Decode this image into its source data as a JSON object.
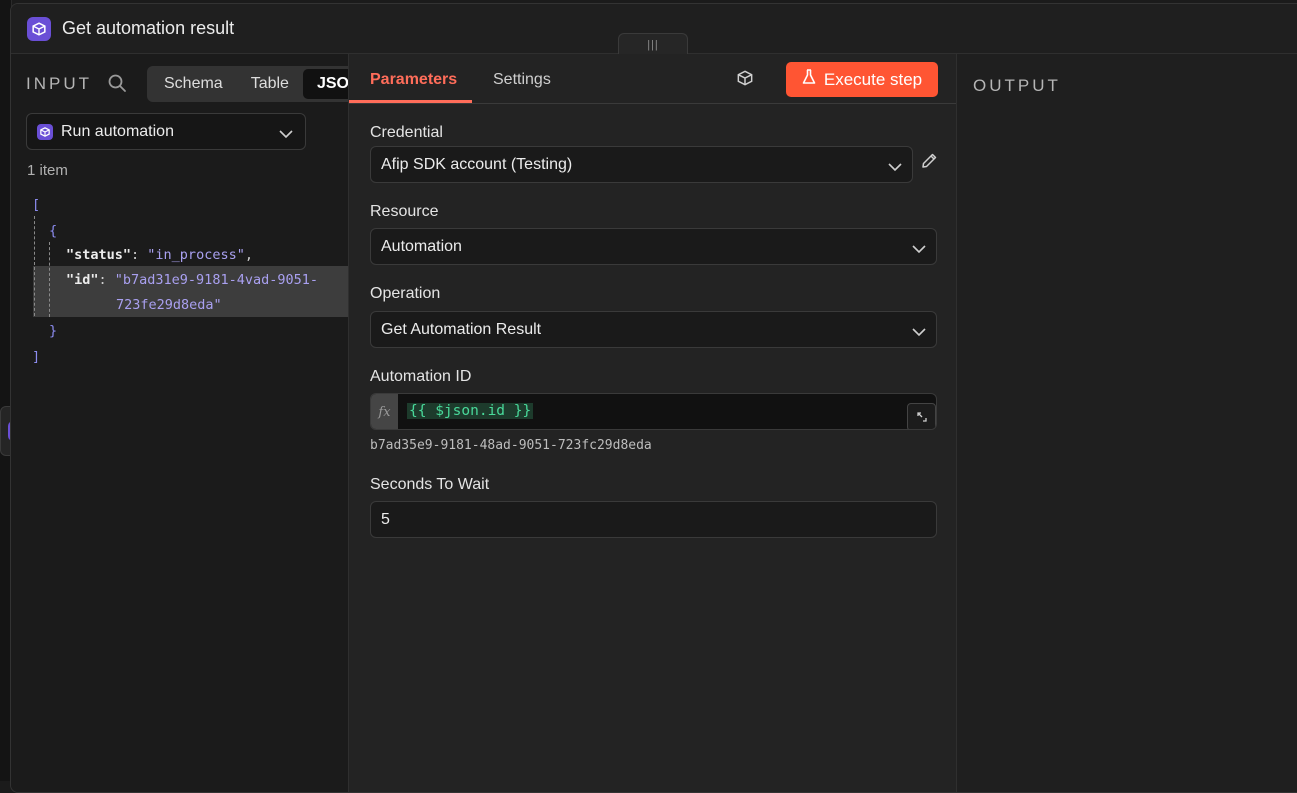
{
  "modal": {
    "title": "Get automation result",
    "drag_handle": "|||"
  },
  "input": {
    "label": "INPUT",
    "view_tabs": [
      "Schema",
      "Table",
      "JSON"
    ],
    "active_view": "JSON",
    "node_select": "Run automation",
    "item_count": "1 item",
    "json": {
      "open_bracket": "[",
      "open_brace": "{",
      "key_status": "\"status\"",
      "val_status": "\"in_process\"",
      "key_id": "\"id\"",
      "val_id_1": "\"b7ad31e9-9181-4vad-9051-",
      "val_id_2": "723fe29d8eda\"",
      "close_brace": "}",
      "close_bracket": "]"
    }
  },
  "params": {
    "tabs": {
      "parameters": "Parameters",
      "settings": "Settings"
    },
    "execute_label": "Execute step",
    "credential_label": "Credential",
    "credential_value": "Afip SDK account (Testing)",
    "resource_label": "Resource",
    "resource_value": "Automation",
    "operation_label": "Operation",
    "operation_value": "Get Automation Result",
    "automation_id_label": "Automation ID",
    "expression_fx": "fx",
    "automation_id_expression": "{{ $json.id }}",
    "automation_id_result": "b7ad35e9-9181-48ad-9051-723fc29d8eda",
    "seconds_label": "Seconds To Wait",
    "seconds_value": "5"
  },
  "output": {
    "label": "OUTPUT"
  },
  "colors": {
    "accent": "#ff6d5a",
    "execute_bg": "#ff5533",
    "node_icon": "#6a4fd6",
    "expr_green": "#49d99a"
  }
}
